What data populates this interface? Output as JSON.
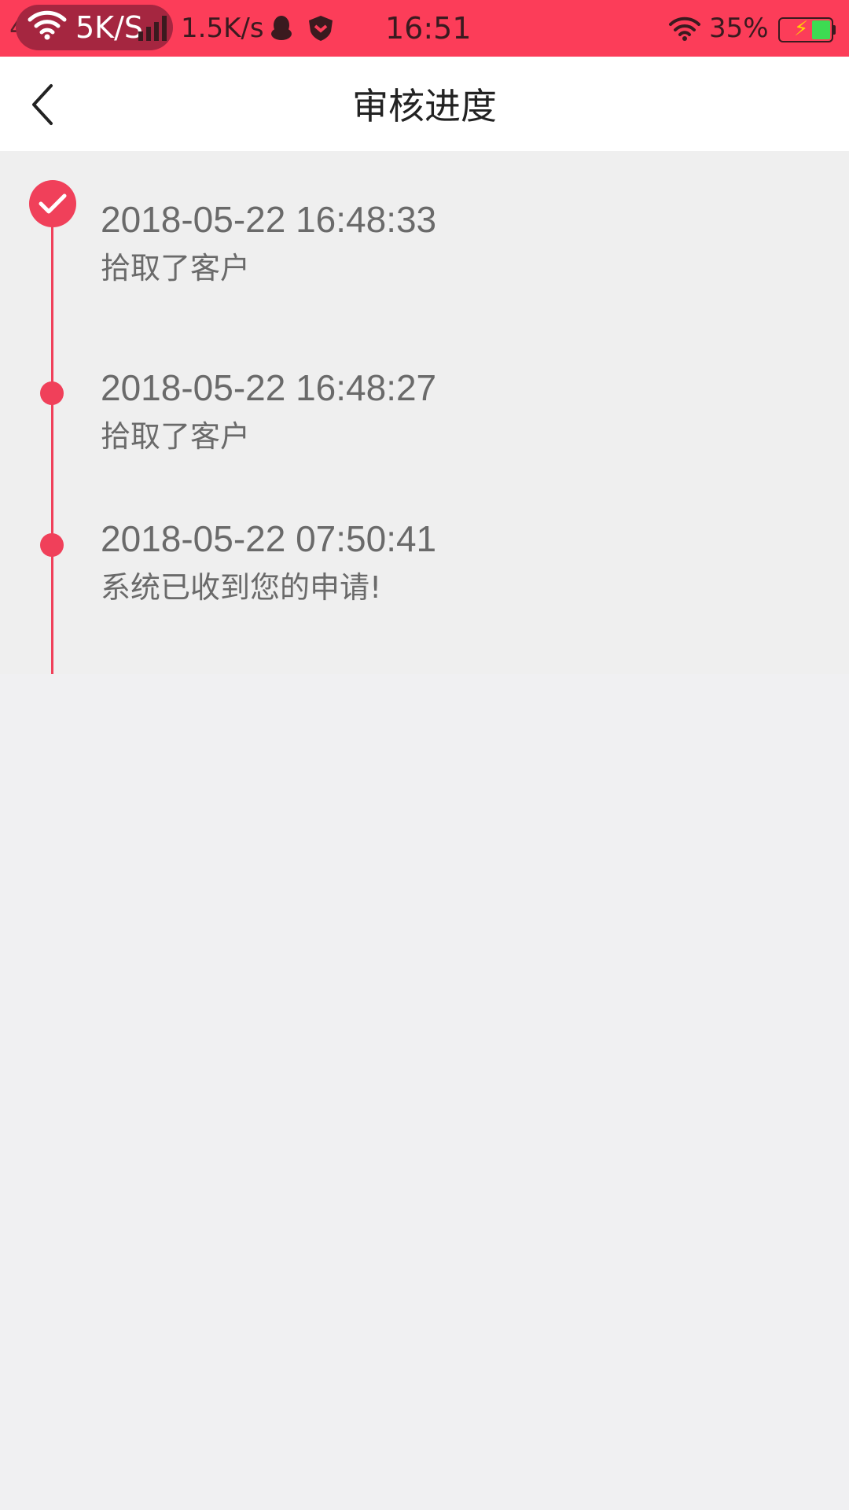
{
  "status_bar": {
    "network_label": "5K/S",
    "signal_prefix": "4",
    "speed": "1.5K/s",
    "time": "16:51",
    "battery_percent": "35%",
    "battery_level": 0.35,
    "icons": [
      "wifi-icon",
      "signal-bars-icon",
      "qq-penguin-icon",
      "shield-icon",
      "wifi-icon",
      "battery-charging-icon"
    ]
  },
  "nav": {
    "back_icon": "chevron-left-icon",
    "title": "审核进度"
  },
  "timeline": {
    "accent_color": "#f0405a",
    "items": [
      {
        "time": "2018-05-22 16:48:33",
        "desc": "拾取了客户",
        "state": "current",
        "icon": "check-icon"
      },
      {
        "time": "2018-05-22 16:48:27",
        "desc": "拾取了客户",
        "state": "done"
      },
      {
        "time": "2018-05-22 07:50:41",
        "desc": "系统已收到您的申请!",
        "state": "done"
      }
    ]
  },
  "colors": {
    "status_bar": "#fc3d59",
    "background": "#f0f0f2",
    "text_secondary": "#6a6a6a"
  }
}
